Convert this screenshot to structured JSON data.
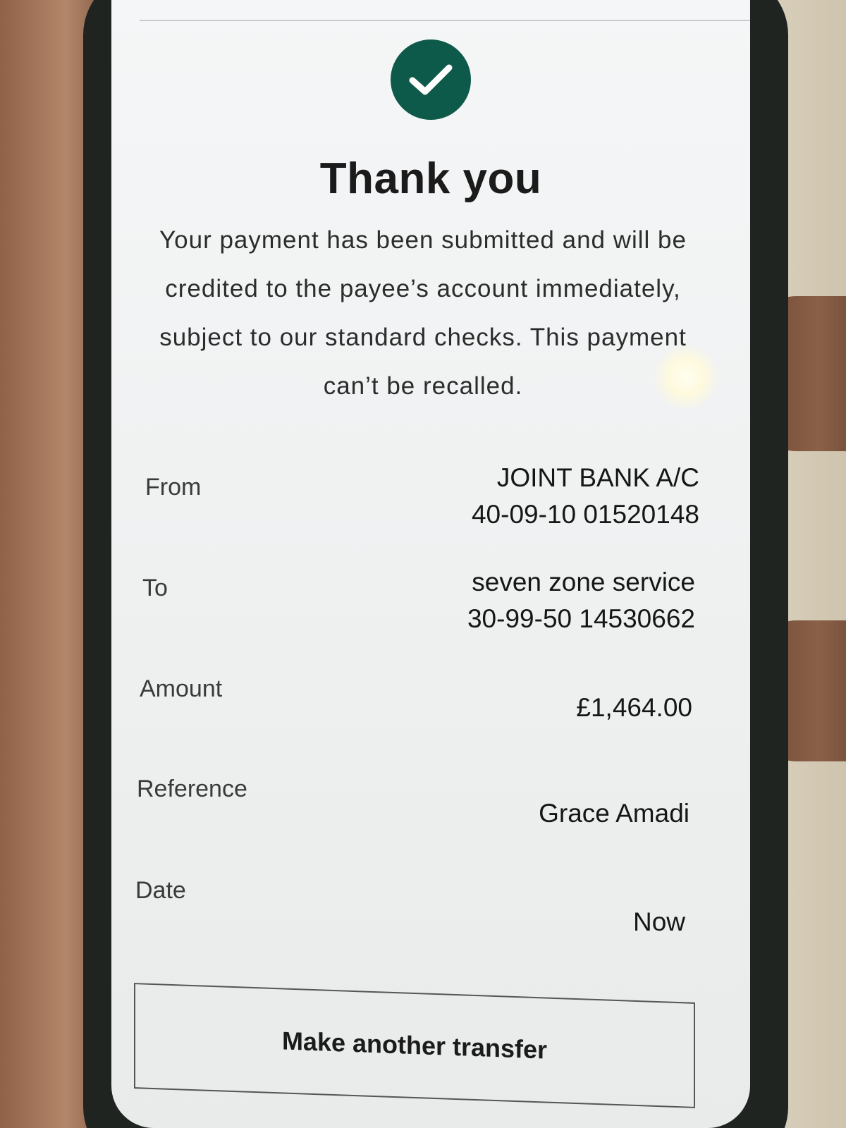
{
  "confirmation": {
    "title": "Thank you",
    "message": "Your payment has been submitted and will be credited to the payee’s account immediately, subject to our standard checks. This payment can’t be recalled."
  },
  "details": {
    "from": {
      "label": "From",
      "account_name": "JOINT BANK A/C",
      "account_number": "40-09-10 01520148"
    },
    "to": {
      "label": "To",
      "payee_name": "seven zone service",
      "account_number": "30-99-50 14530662"
    },
    "amount": {
      "label": "Amount",
      "value": "£1,464.00"
    },
    "reference": {
      "label": "Reference",
      "value": "Grace Amadi"
    },
    "date": {
      "label": "Date",
      "value": "Now"
    }
  },
  "actions": {
    "another_transfer_label": "Make another transfer"
  },
  "icons": {
    "success": "checkmark-circle-icon"
  },
  "colors": {
    "accent": "#0e5a4a",
    "text": "#1b1b1b"
  }
}
